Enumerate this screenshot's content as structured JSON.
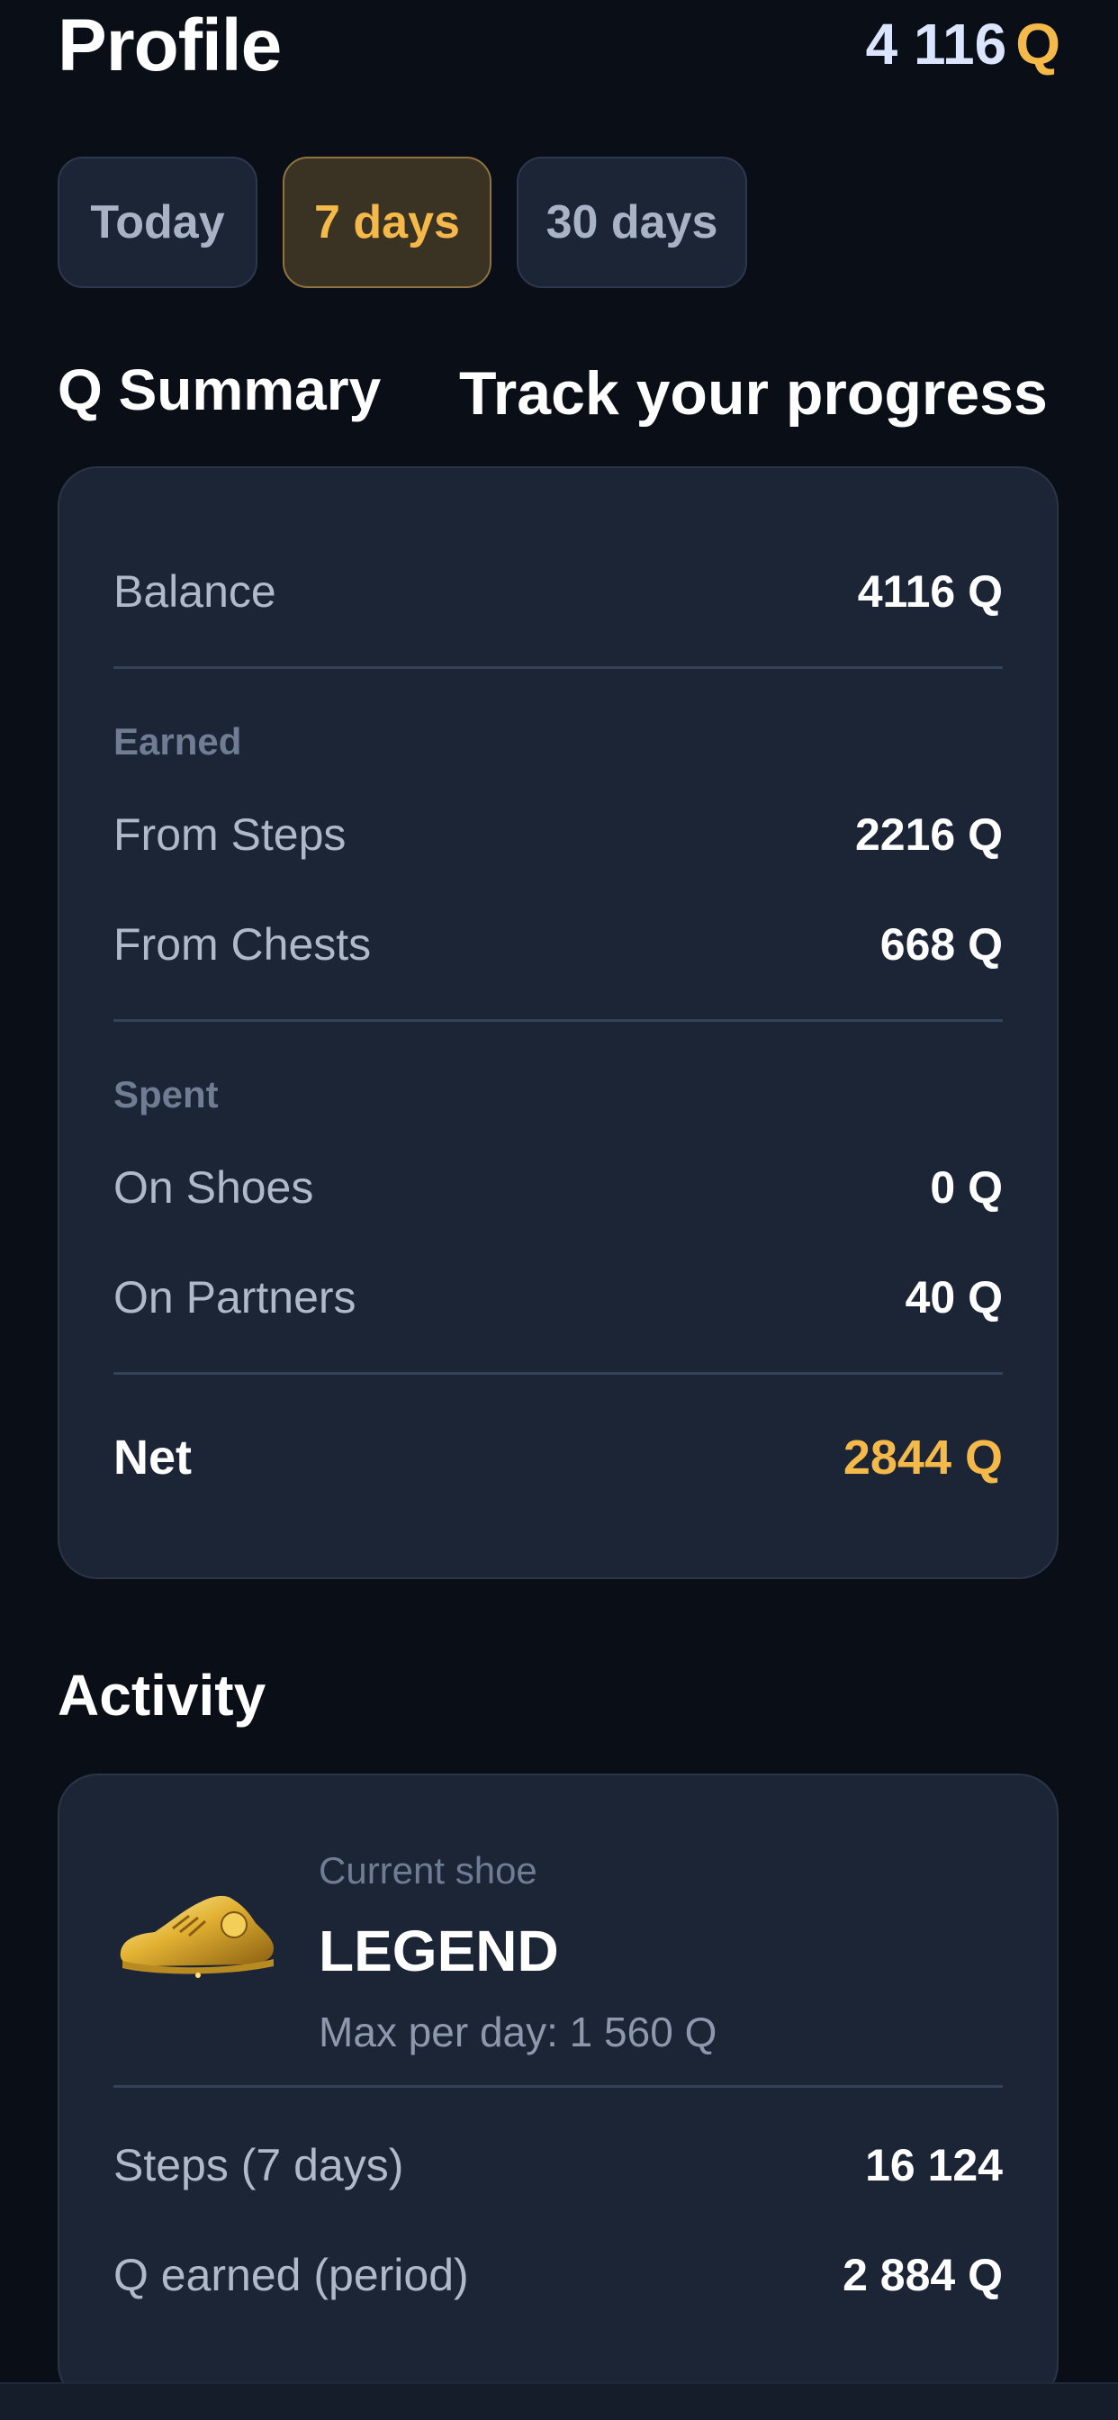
{
  "header": {
    "title": "Profile",
    "balance_value": "4 116",
    "balance_unit": "Q"
  },
  "tabs": [
    {
      "label": "Today",
      "active": false
    },
    {
      "label": "7 days",
      "active": true
    },
    {
      "label": "30 days",
      "active": false
    }
  ],
  "summary": {
    "section_title": "Q Summary",
    "tagline": "Track your progress",
    "balance": {
      "label": "Balance",
      "value": "4116 Q"
    },
    "earned": {
      "heading": "Earned",
      "from_steps": {
        "label": "From Steps",
        "value": "2216 Q"
      },
      "from_chests": {
        "label": "From Chests",
        "value": "668 Q"
      }
    },
    "spent": {
      "heading": "Spent",
      "on_shoes": {
        "label": "On Shoes",
        "value": "0 Q"
      },
      "on_partners": {
        "label": "On Partners",
        "value": "40 Q"
      }
    },
    "net": {
      "label": "Net",
      "value": "2844 Q"
    }
  },
  "activity": {
    "section_title": "Activity",
    "shoe_caption": "Current shoe",
    "shoe_name": "LEGEND",
    "shoe_max": "Max per day: 1 560 Q",
    "shoe_icon": "golden-sneaker-icon",
    "steps": {
      "label": "Steps (7 days)",
      "value": "16 124"
    },
    "q_earned": {
      "label": "Q earned (period)",
      "value": "2 884 Q"
    }
  },
  "colors": {
    "background": "#0a0e17",
    "card": "#1c2536",
    "accent": "#f5b94a",
    "muted": "#6f7c93"
  }
}
